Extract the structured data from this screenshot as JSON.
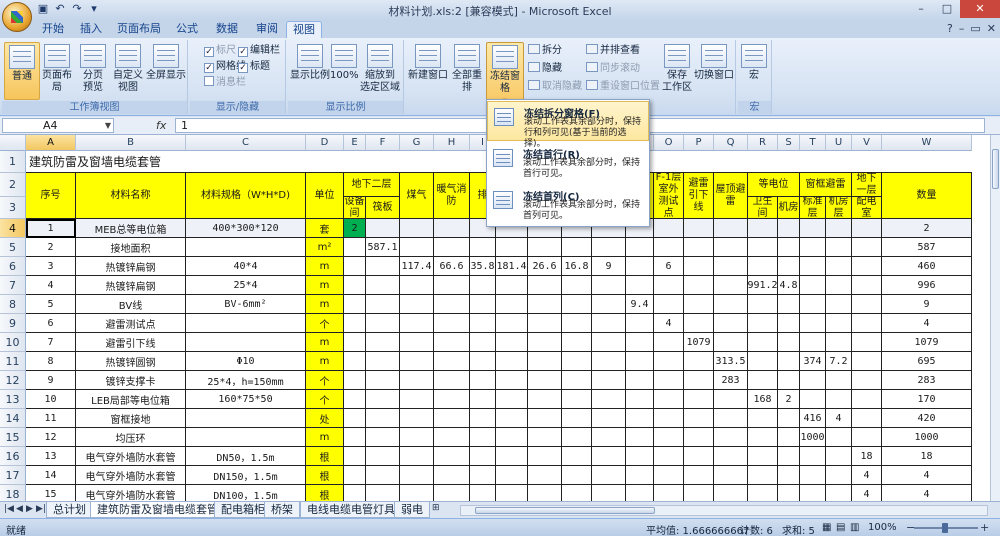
{
  "window": {
    "title": "材料计划.xls:2 [兼容模式] - Microsoft Excel",
    "controls": {
      "minimize": "–",
      "maximize": "□",
      "close": "✕"
    }
  },
  "tabs": [
    "开始",
    "插入",
    "页面布局",
    "公式",
    "数据",
    "审阅",
    "视图"
  ],
  "active_tab": "视图",
  "ribbon": {
    "views": {
      "label": "工作簿视图",
      "normal": "普通",
      "page_layout": "页面布局",
      "page_break": "分页\n预览",
      "custom": "自定义\n视图",
      "full": "全屏显示"
    },
    "show_hide": {
      "label": "显示/隐藏",
      "ruler": "标尺",
      "formula_bar": "编辑栏",
      "gridlines": "网格线",
      "headings": "标题",
      "message_bar": "消息栏"
    },
    "zoom": {
      "label": "显示比例",
      "zoom": "显示比例",
      "zoom100": "100%",
      "zoom_sel": "缩放到\n选定区域"
    },
    "window": {
      "new_window": "新建窗口",
      "arrange_all": "全部重排",
      "freeze": "冻结窗格",
      "split": "拆分",
      "hide": "隐藏",
      "unhide": "取消隐藏",
      "side_by_side": "并排查看",
      "sync_scroll": "同步滚动",
      "reset_pos": "重设窗口位置",
      "save_workspace": "保存\n工作区",
      "switch_windows": "切换窗口"
    },
    "macros": {
      "label": "宏",
      "macro": "宏"
    }
  },
  "freeze_menu": [
    {
      "title": "冻结拆分窗格(F)",
      "desc": "滚动工作表其余部分时，保持行和列可见(基于当前的选择)。"
    },
    {
      "title": "冻结首行(R)",
      "desc": "滚动工作表其余部分时，保持首行可见。"
    },
    {
      "title": "冻结首列(C)",
      "desc": "滚动工作表其余部分时，保持首列可见。"
    }
  ],
  "formula_bar": {
    "name_box": "A4",
    "fx": "fx",
    "value": "1"
  },
  "columns": [
    "A",
    "B",
    "C",
    "D",
    "E",
    "F",
    "G",
    "H",
    "I",
    "J",
    "K",
    "L",
    "M",
    "N",
    "O",
    "P",
    "Q",
    "R",
    "S",
    "T",
    "U",
    "V",
    "W"
  ],
  "row_numbers": [
    "1",
    "2",
    "3",
    "4",
    "5",
    "6",
    "7",
    "8",
    "9",
    "10",
    "11",
    "12",
    "13",
    "14",
    "15",
    "16",
    "17",
    "18"
  ],
  "sheet": {
    "title": "建筑防雷及窗墙电缆套管",
    "headers": {
      "seq": "序号",
      "name": "材料名称",
      "spec": "材料规格（W*H*D)",
      "unit": "单位",
      "basement2": "地下二层",
      "equip_room": "设备间",
      "garage": "筏板",
      "gas": "煤气",
      "hvac": "暖气消防",
      "drain": "排",
      "f1_ext": "F-1层室外测试点",
      "lightning_down": "避雷引下线",
      "roof": "屋顶避雷",
      "equipot": "等电位",
      "bathroom": "卫生间",
      "machine": "机房",
      "window_grid": "窗框避雷",
      "standard": "标准层",
      "machine2": "机房层",
      "basement1": "地下一层",
      "power_room": "配电室",
      "qty": "数量",
      "col_n": "电话",
      "col_h3": "管道井"
    },
    "rows": [
      {
        "n": "1",
        "name": "MEB总等电位箱",
        "spec": "400*300*120",
        "unit": "套",
        "E": "2",
        "qty": "2"
      },
      {
        "n": "2",
        "name": "接地面积",
        "spec": "",
        "unit": "m²",
        "F": "587.1",
        "qty": "587"
      },
      {
        "n": "3",
        "name": "热镀锌扁钢",
        "spec": "40*4",
        "unit": "m",
        "G": "117.4",
        "H": "66.6",
        "I": "35.8",
        "J": "181.4",
        "K": "26.6",
        "L": "16.8",
        "M": "9",
        "O": "6",
        "qty": "460"
      },
      {
        "n": "4",
        "name": "热镀锌扁钢",
        "spec": "25*4",
        "unit": "m",
        "R": "991.2",
        "S": "4.8",
        "qty": "996"
      },
      {
        "n": "5",
        "name": "BV线",
        "spec": "BV-6mm²",
        "unit": "m",
        "N": "9.4",
        "qty": "9"
      },
      {
        "n": "6",
        "name": "避雷测试点",
        "spec": "",
        "unit": "个",
        "O": "4",
        "qty": "4"
      },
      {
        "n": "7",
        "name": "避雷引下线",
        "spec": "",
        "unit": "m",
        "P": "1079",
        "qty": "1079"
      },
      {
        "n": "8",
        "name": "热镀锌圆钢",
        "spec": "Φ10",
        "unit": "m",
        "Q": "313.5",
        "T": "374",
        "U": "7.2",
        "qty": "695"
      },
      {
        "n": "9",
        "name": "镀锌支撑卡",
        "spec": "25*4，h=150mm",
        "unit": "个",
        "Q": "283",
        "qty": "283"
      },
      {
        "n": "10",
        "name": "LEB局部等电位箱",
        "spec": "160*75*50",
        "unit": "个",
        "R": "168",
        "S": "2",
        "qty": "170"
      },
      {
        "n": "11",
        "name": "窗框接地",
        "spec": "",
        "unit": "处",
        "T": "416",
        "U": "4",
        "qty": "420"
      },
      {
        "n": "12",
        "name": "均压环",
        "spec": "",
        "unit": "m",
        "T": "1000",
        "qty": "1000"
      },
      {
        "n": "13",
        "name": "电气穿外墙防水套管",
        "spec": "DN50，1.5m",
        "unit": "根",
        "V": "18",
        "qty": "18"
      },
      {
        "n": "14",
        "name": "电气穿外墙防水套管",
        "spec": "DN150，1.5m",
        "unit": "根",
        "V": "4",
        "qty": "4"
      },
      {
        "n": "15",
        "name": "电气穿外墙防水套管",
        "spec": "DN100，1.5m",
        "unit": "根",
        "V": "4",
        "qty": "4"
      }
    ]
  },
  "sheet_tabs": [
    "总计划",
    "建筑防雷及窗墙电缆套管",
    "配电箱柜",
    "桥架",
    "电线电缆电管灯具",
    "弱电"
  ],
  "active_sheet": "建筑防雷及窗墙电缆套管",
  "status": {
    "ready": "就绪",
    "average": "平均值: 1.666666667",
    "count": "计数: 6",
    "sum": "求和: 5",
    "zoom": "100%"
  },
  "watermark": "Baidu经验 jingyan.baidu.com",
  "colors": {
    "yellow": "#ffff00",
    "green": "#00b050",
    "ribbon_bg": "#dbe5f1"
  }
}
